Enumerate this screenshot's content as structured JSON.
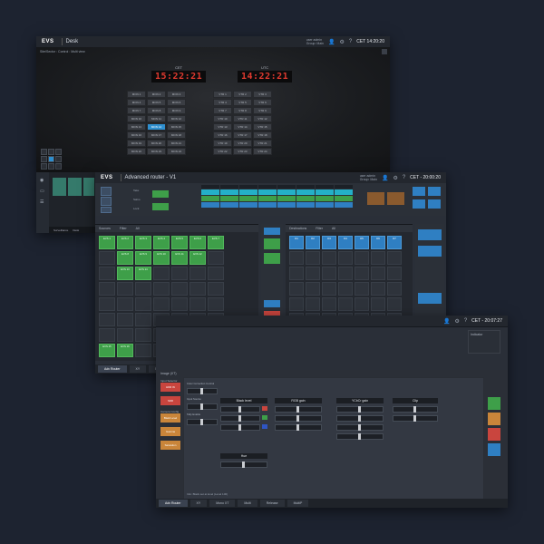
{
  "desk": {
    "app_name": "Desk",
    "logo": "EVS",
    "user_line1": "user admin",
    "user_line2": "Group: Main",
    "clock": "CET 14:20:20",
    "breadcrumb": "Site/Sector : Control : Multi view",
    "clocks": [
      {
        "label": "CET",
        "time": "15:22:21"
      },
      {
        "label": "UTC",
        "time": "14:22:21"
      }
    ],
    "matrix_left": [
      "MON 1",
      "MON 2",
      "MON 3",
      "MON 4",
      "MON 5",
      "MON 6",
      "MON 7",
      "MON 8",
      "MON 9",
      "MON 10",
      "MON 11",
      "MON 12",
      "MON 13",
      "MON 14",
      "MON 15",
      "MON 16",
      "MON 17",
      "MON 18",
      "MON 19",
      "MON 20",
      "MON 21",
      "MON 22",
      "MON 23",
      "MON 24"
    ],
    "matrix_right": [
      "VTR 1",
      "VTR 2",
      "VTR 3",
      "VTR 4",
      "VTR 5",
      "VTR 6",
      "VTR 7",
      "VTR 8",
      "VTR 9",
      "VTR 10",
      "VTR 11",
      "VTR 12",
      "VTR 13",
      "VTR 14",
      "VTR 15",
      "VTR 16",
      "VTR 17",
      "VTR 18",
      "VTR 19",
      "VTR 20",
      "VTR 21",
      "VTR 22",
      "VTR 23",
      "VTR 24"
    ]
  },
  "router": {
    "logo": "EVS",
    "app_name": "Advanced router - V1",
    "user_line1": "user admin",
    "user_line2": "Group: Main",
    "clock": "CET - 20:00:20",
    "sources_title": "Sources",
    "dest_title": "Destinations",
    "source_filters": [
      "Filter",
      "All"
    ],
    "dest_filters": [
      "Filter",
      "All"
    ],
    "source_buttons": [
      "EVS 1",
      "EVS 2",
      "EVS 3",
      "EVS 4",
      "EVS 5",
      "EVS 6",
      "EVS 7",
      "EVS 8",
      "EVS 9",
      "EVS 10",
      "EVS 11",
      "EVS 12",
      "EVS 13",
      "EVS 14",
      "EVS 15",
      "EVS 16",
      "EVS 17",
      "EVS 18",
      "EVS 19",
      "EVS 20"
    ],
    "dest_buttons": [
      "D1",
      "D2",
      "D3",
      "D4",
      "D5",
      "D6",
      "D7",
      "D8"
    ],
    "bottom_tabs": [
      "Adv Router",
      "XY",
      "Mono",
      "Multi",
      "Release",
      "MultiP"
    ],
    "side_labels": [
      "Take",
      "Salvo",
      "Lock"
    ],
    "lower_tabs": [
      "Surveillance",
      "Desk"
    ]
  },
  "image": {
    "section_title": "Image (XT)",
    "menu_label": "Input Selector",
    "buttons_left": [
      "HDR IN",
      "SDR"
    ],
    "camera_label": "Camera Config",
    "orange_buttons": [
      "Black Level",
      "Gamma",
      "Saturation"
    ],
    "fields": [
      "Color Correction Control",
      "Input Source",
      "Tally Enable"
    ],
    "groups": [
      {
        "title": "Black level"
      },
      {
        "title": "RGB gain"
      },
      {
        "title": "YCbCr gain"
      },
      {
        "title": "Clip"
      },
      {
        "title": "Hue"
      }
    ],
    "indicator_title": "Indicator",
    "status": "Info: Black set at level (Level 100)",
    "clock": "CET - 20:07:27",
    "bottom_tabs": [
      "Adv Router",
      "XY",
      "Mono XT",
      "Multi",
      "Release",
      "MultiP"
    ]
  }
}
